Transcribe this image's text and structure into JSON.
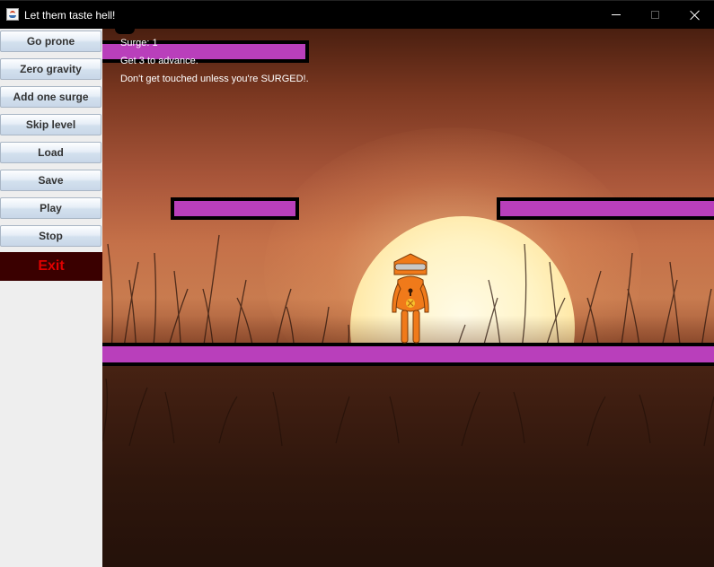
{
  "window": {
    "title": "Let them taste hell!",
    "icon": "java-cup-icon",
    "controls": [
      "minimize-icon",
      "maximize-icon",
      "close-icon"
    ]
  },
  "sidebar": {
    "buttons": [
      {
        "label": "Go prone"
      },
      {
        "label": "Zero gravity"
      },
      {
        "label": "Add one surge"
      },
      {
        "label": "Skip level"
      },
      {
        "label": "Load"
      },
      {
        "label": "Save"
      },
      {
        "label": "Play"
      },
      {
        "label": "Stop"
      }
    ],
    "exit_label": "Exit"
  },
  "hud": {
    "surge_line": "Surge: 1",
    "goal_line": "Get 3 to advance.",
    "warning_line": "Don't get touched unless you're SURGED!."
  },
  "colors": {
    "platform_fill": "#b93fbb",
    "platform_border": "#000000",
    "player": "#f07a1a",
    "exit_text": "#e00000",
    "exit_bg": "#3a0000"
  }
}
